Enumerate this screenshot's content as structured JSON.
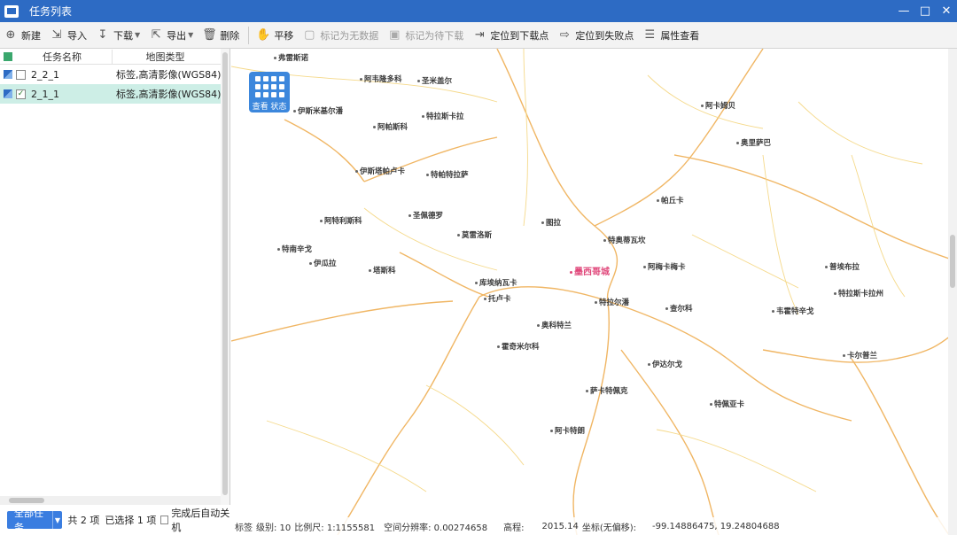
{
  "window": {
    "title": "任务列表"
  },
  "toolbar": {
    "new": "新建",
    "import": "导入",
    "download": "下载",
    "export": "导出",
    "delete": "删除",
    "pan": "平移",
    "mark_no_data": "标记为无数据",
    "mark_to_download": "标记为待下载",
    "locate_next": "定位到下载点",
    "locate_fail": "定位到失败点",
    "properties": "属性查看"
  },
  "task_list": {
    "col_name": "任务名称",
    "col_type": "地图类型",
    "rows": [
      {
        "name": "2_2_1",
        "type": "标签,高清影像(WGS84)",
        "checked": false
      },
      {
        "name": "2_1_1",
        "type": "标签,高清影像(WGS84)",
        "checked": true
      }
    ]
  },
  "footer": {
    "all_tasks": "全部任务",
    "total": "共 2 项",
    "selected": "已选择 1 项",
    "auto_shutdown": "完成后自动关机"
  },
  "map": {
    "view_status": "查看 状态",
    "city": "墨西哥城",
    "labels": [
      "弗雷斯诺",
      "阿韦隆多科",
      "圣米盖尔",
      "伊斯米基尔潘",
      "特拉斯卡拉",
      "阿帕斯科",
      "伊斯塔帕卢卡",
      "特帕特拉萨",
      "阿特利斯科",
      "圣佩德罗",
      "莫雷洛斯",
      "库埃纳瓦卡",
      "托卢卡",
      "特南辛戈",
      "伊瓜拉",
      "塔斯科",
      "奥科特兰",
      "霍奇米尔科",
      "特拉尔潘",
      "查尔科",
      "阿梅卡梅卡",
      "特奥蒂瓦坎",
      "帕丘卡",
      "图拉",
      "阿卡姆贝",
      "奥里萨巴",
      "普埃布拉",
      "特拉斯卡拉州",
      "韦霍特辛戈",
      "卡尔普兰",
      "伊达尔戈",
      "萨卡特佩克",
      "阿卡特朗",
      "特佩亚卡"
    ]
  },
  "status": {
    "layer": "标签",
    "level": "级别: 10",
    "scale": "比例尺: 1:1155581",
    "resolution": "空间分辨率: 0.00274658",
    "elevation_label": "高程:",
    "elevation": "2015.14",
    "coord_label": "坐标(无偏移):",
    "coord": "-99.14886475, 19.24804688"
  }
}
